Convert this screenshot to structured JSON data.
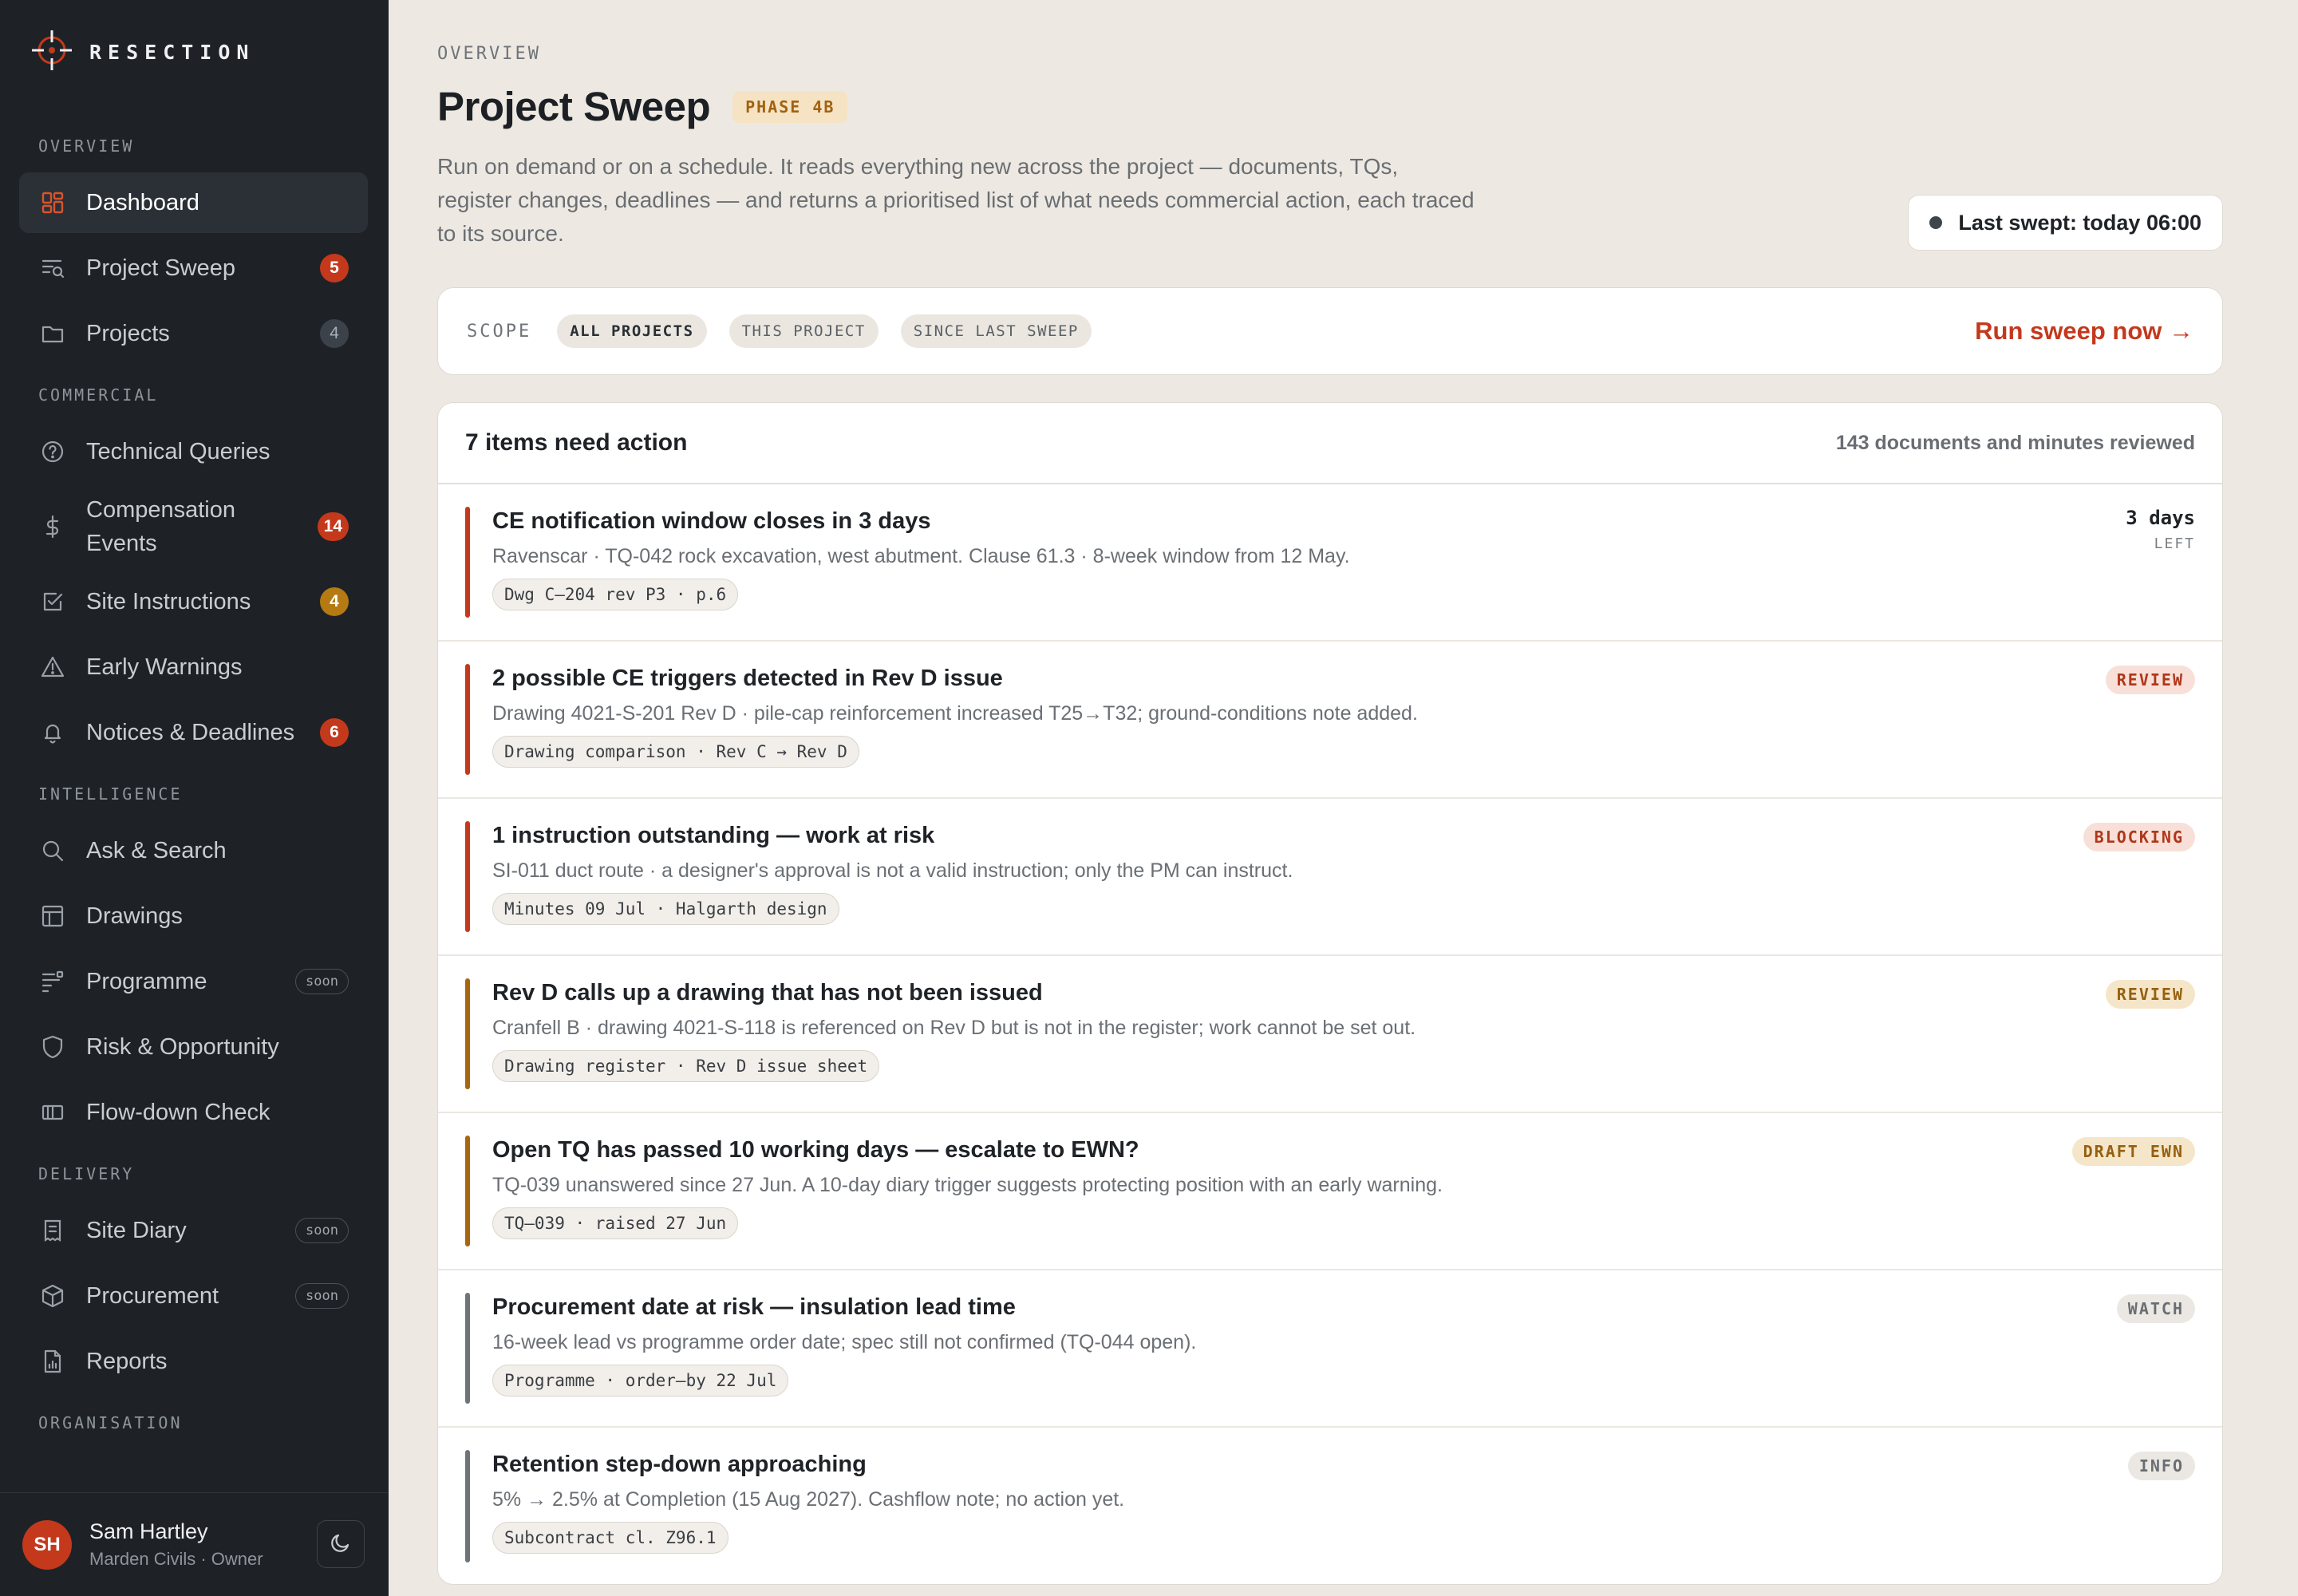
{
  "brand": {
    "name": "RESECTION"
  },
  "sidebar": {
    "sections": {
      "overview": "OVERVIEW",
      "commercial": "COMMERCIAL",
      "intelligence": "INTELLIGENCE",
      "delivery": "DELIVERY",
      "organisation": "ORGANISATION"
    },
    "items": {
      "dashboard": {
        "label": "Dashboard",
        "icon": "grid-icon"
      },
      "project_sweep": {
        "label": "Project Sweep",
        "badge": "5",
        "icon": "sweep-icon"
      },
      "projects": {
        "label": "Projects",
        "badge": "4",
        "icon": "folder-icon"
      },
      "technical_queries": {
        "label": "Technical Queries",
        "icon": "question-icon"
      },
      "compensation_events": {
        "label": "Compensation Events",
        "badge": "14",
        "icon": "dollar-icon"
      },
      "site_instructions": {
        "label": "Site Instructions",
        "badge": "4",
        "icon": "checkbox-icon"
      },
      "early_warnings": {
        "label": "Early Warnings",
        "icon": "warning-icon"
      },
      "notices_deadlines": {
        "label": "Notices & Deadlines",
        "badge": "6",
        "icon": "bell-icon"
      },
      "ask_search": {
        "label": "Ask & Search",
        "icon": "search-icon"
      },
      "drawings": {
        "label": "Drawings",
        "icon": "layout-icon"
      },
      "programme": {
        "label": "Programme",
        "tag": "soon",
        "icon": "programme-icon"
      },
      "risk_opportunity": {
        "label": "Risk & Opportunity",
        "icon": "shield-icon"
      },
      "flow_down": {
        "label": "Flow-down Check",
        "icon": "columns-icon"
      },
      "site_diary": {
        "label": "Site Diary",
        "tag": "soon",
        "icon": "diary-icon"
      },
      "procurement": {
        "label": "Procurement",
        "tag": "soon",
        "icon": "box-icon"
      },
      "reports": {
        "label": "Reports",
        "icon": "report-icon"
      }
    },
    "user": {
      "initials": "SH",
      "name": "Sam Hartley",
      "role": "Marden Civils · Owner"
    }
  },
  "header": {
    "eyebrow": "OVERVIEW",
    "title": "Project Sweep",
    "phase": "PHASE 4B",
    "intro": "Run on demand or on a schedule. It reads everything new across the project — documents, TQs, register changes, deadlines — and returns a prioritised list of what needs commercial action, each traced to its source.",
    "last_swept": "Last swept: today 06:00"
  },
  "scope": {
    "label": "SCOPE",
    "options": [
      "ALL PROJECTS",
      "THIS PROJECT",
      "SINCE LAST SWEEP"
    ],
    "run_label": "Run sweep now →"
  },
  "results": {
    "title": "7 items need action",
    "meta": "143 documents and minutes reviewed",
    "items": [
      {
        "title": "CE notification window closes in 3 days",
        "desc": "Ravenscar · TQ-042 rock excavation, west abutment. Clause 61.3 · 8-week window from 12 May.",
        "ref": "Dwg C–204 rev P3 · p.6",
        "days": "3 days",
        "days_label": "LEFT",
        "color": "#c4391c"
      },
      {
        "title": "2 possible CE triggers detected in Rev D issue",
        "desc": "Drawing 4021-S-201 Rev D · pile-cap reinforcement increased T25→T32; ground-conditions note added.",
        "ref": "Drawing comparison · Rev C → Rev D",
        "status": "REVIEW",
        "color": "#c4391c"
      },
      {
        "title": "1 instruction outstanding — work at risk",
        "desc": "SI-011 duct route · a designer's approval is not a valid instruction; only the PM can instruct.",
        "ref": "Minutes 09 Jul · Halgarth design",
        "status": "BLOCKING",
        "color": "#c4391c"
      },
      {
        "title": "Rev D calls up a drawing that has not been issued",
        "desc": "Cranfell B · drawing 4021-S-118 is referenced on Rev D but is not in the register; work cannot be set out.",
        "ref": "Drawing register · Rev D issue sheet",
        "status": "REVIEW",
        "color": "#a8670f"
      },
      {
        "title": "Open TQ has passed 10 working days — escalate to EWN?",
        "desc": "TQ-039 unanswered since 27 Jun. A 10-day diary trigger suggests protecting position with an early warning.",
        "ref": "TQ–039 · raised 27 Jun",
        "status": "DRAFT EWN",
        "color": "#a8670f"
      },
      {
        "title": "Procurement date at risk — insulation lead time",
        "desc": "16-week lead vs programme order date; spec still not confirmed (TQ-044 open).",
        "ref": "Programme · order–by 22 Jul",
        "status": "WATCH",
        "color": "#6f747a"
      },
      {
        "title": "Retention step-down approaching",
        "desc": "5% → 2.5% at Completion (15 Aug 2027). Cashflow note; no action yet.",
        "ref": "Subcontract cl. Z96.1",
        "status": "INFO",
        "color": "#6f747a"
      }
    ]
  }
}
